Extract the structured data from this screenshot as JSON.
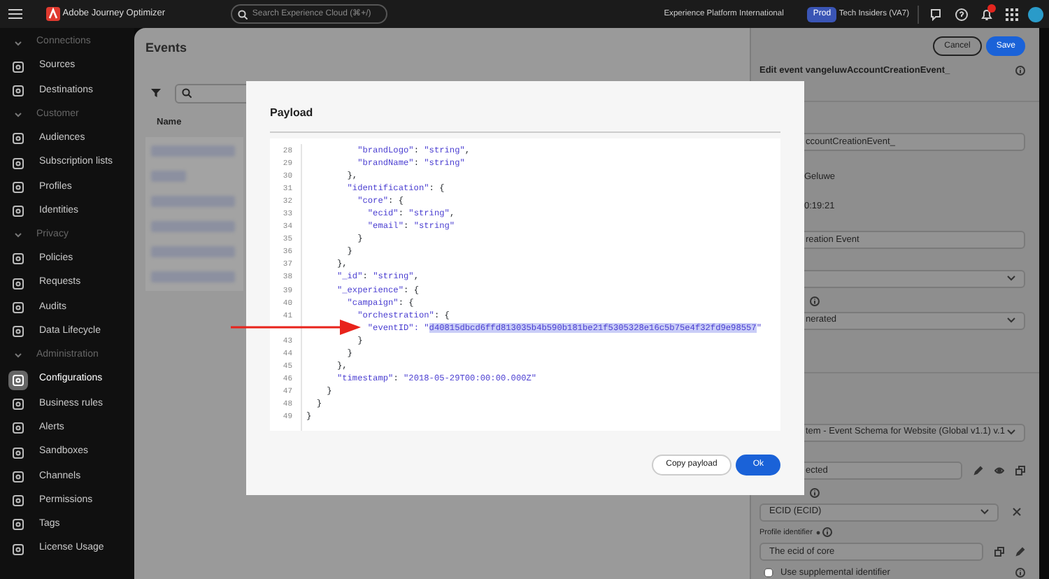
{
  "top_bar": {
    "app_name": "Adobe Journey Optimizer",
    "search": {
      "placeholder": "Search Experience Cloud (⌘+/)"
    },
    "org": "Experience Platform International",
    "sandbox_badge": "Prod",
    "sandbox": "Tech Insiders (VA7)",
    "has_notifications": true
  },
  "sidebar": {
    "sections": [
      {
        "title": "Connections",
        "expanded": true,
        "items": [
          {
            "label": "Sources",
            "selected": false
          },
          {
            "label": "Destinations",
            "selected": false
          }
        ]
      },
      {
        "title": "Customer",
        "expanded": true,
        "items": [
          {
            "label": "Audiences",
            "selected": false
          },
          {
            "label": "Subscription lists",
            "selected": false
          },
          {
            "label": "Profiles",
            "selected": false
          },
          {
            "label": "Identities",
            "selected": false
          }
        ]
      },
      {
        "title": "Privacy",
        "expanded": true,
        "items": [
          {
            "label": "Policies",
            "selected": false
          },
          {
            "label": "Requests",
            "selected": false
          },
          {
            "label": "Audits",
            "selected": false
          },
          {
            "label": "Data Lifecycle",
            "selected": false
          }
        ]
      },
      {
        "title": "Administration",
        "expanded": true,
        "items": [
          {
            "label": "Configurations",
            "selected": true
          },
          {
            "label": "Business rules",
            "selected": false
          },
          {
            "label": "Alerts",
            "selected": false
          },
          {
            "label": "Sandboxes",
            "selected": false
          },
          {
            "label": "Channels",
            "selected": false
          },
          {
            "label": "Permissions",
            "selected": false
          },
          {
            "label": "Tags",
            "selected": false
          },
          {
            "label": "License Usage",
            "selected": false
          }
        ]
      }
    ]
  },
  "events_list": {
    "title": "Events",
    "column": "Name"
  },
  "edit_panel": {
    "cancel": "Cancel",
    "save": "Save",
    "title": "Edit event vangeluwAccountCreationEvent_",
    "rows": [
      {
        "kind": "input",
        "value": "ccountCreationEvent_"
      },
      {
        "kind": "text",
        "value": "Geluwe"
      },
      {
        "kind": "text",
        "value": "0:19:21"
      },
      {
        "kind": "input",
        "value": "reation Event"
      },
      {
        "kind": "select",
        "value": ""
      },
      {
        "kind": "info"
      },
      {
        "kind": "select",
        "value": "nerated"
      },
      {
        "kind": "divider"
      },
      {
        "kind": "select",
        "value": "tem - Event Schema for Website (Global v1.1) v.1"
      },
      {
        "kind": "field-actions",
        "value": "ected"
      },
      {
        "kind": "info"
      },
      {
        "kind": "select-clear",
        "value": "ECID (ECID)"
      },
      {
        "kind": "label",
        "value": "Profile identifier",
        "required": true
      },
      {
        "kind": "field-copy",
        "value": "The ecid of core"
      },
      {
        "kind": "checkbox",
        "value": "Use supplemental identifier",
        "checked": false
      }
    ]
  },
  "payload_dialog": {
    "title": "Payload",
    "lines": [
      {
        "number": "28",
        "code": "          \"brandLogo\": \"string\","
      },
      {
        "number": "29",
        "code": "          \"brandName\": \"string\""
      },
      {
        "number": "30",
        "code": "        },"
      },
      {
        "number": "31",
        "code": "        \"identification\": {"
      },
      {
        "number": "32",
        "code": "          \"core\": {"
      },
      {
        "number": "33",
        "code": "            \"ecid\": \"string\","
      },
      {
        "number": "34",
        "code": "            \"email\": \"string\""
      },
      {
        "number": "35",
        "code": "          }"
      },
      {
        "number": "36",
        "code": "        }"
      },
      {
        "number": "37",
        "code": "      },"
      },
      {
        "number": "38",
        "code": "      \"_id\": \"string\","
      },
      {
        "number": "39",
        "code": "      \"_experience\": {"
      },
      {
        "number": "40",
        "code": "        \"campaign\": {"
      },
      {
        "number": "41",
        "code": "          \"orchestration\": {"
      },
      {
        "code": "            \"eventID\": \"",
        "selected_text": "d40815dbcd6ffd813035b4b590b181be21f5305328e16c5b75e4f32fd9e98557",
        "after": "\""
      },
      {
        "number": "43",
        "code": "          }"
      },
      {
        "number": "44",
        "code": "        }"
      },
      {
        "number": "45",
        "code": "      },"
      },
      {
        "number": "46",
        "code": "      \"timestamp\": \"2018-05-29T00:00:00.000Z\""
      },
      {
        "number": "47",
        "code": "    }"
      },
      {
        "number": "48",
        "code": "  }"
      },
      {
        "number": "49",
        "code": "}"
      }
    ],
    "copy_button": "Copy payload",
    "ok_button": "Ok"
  }
}
